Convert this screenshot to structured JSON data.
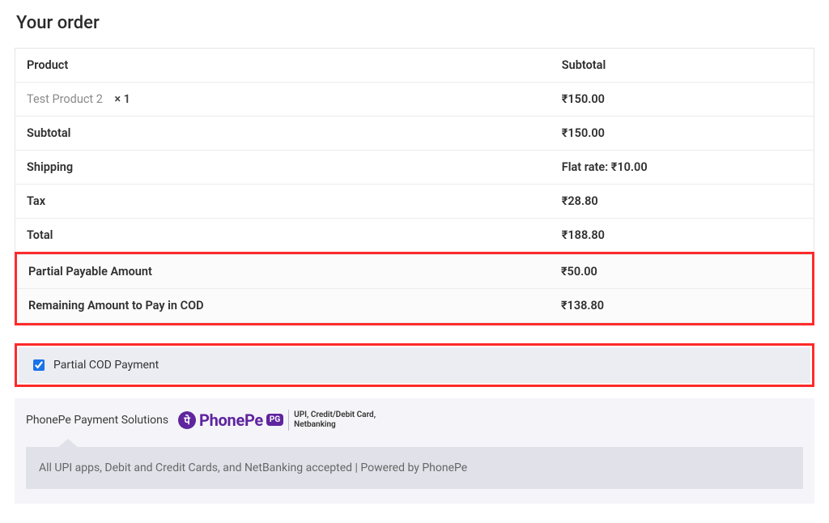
{
  "title": "Your order",
  "headers": {
    "product": "Product",
    "subtotal": "Subtotal"
  },
  "line_item": {
    "name": "Test Product 2",
    "qty_prefix": "× ",
    "qty": "1",
    "total": "₹150.00"
  },
  "rows": {
    "subtotal": {
      "label": "Subtotal",
      "value": "₹150.00"
    },
    "shipping": {
      "label": "Shipping",
      "value": "Flat rate: ₹10.00"
    },
    "tax": {
      "label": "Tax",
      "value": "₹28.80"
    },
    "total": {
      "label": "Total",
      "value": "₹188.80"
    },
    "partial_payable": {
      "label": "Partial Payable Amount",
      "value": "₹50.00"
    },
    "remaining_cod": {
      "label": "Remaining Amount to Pay in COD",
      "value": "₹138.80"
    }
  },
  "payment_option": {
    "label": "Partial COD Payment",
    "checked": true
  },
  "phonepe": {
    "title": "PhonePe Payment Solutions",
    "brand": "PhonePe",
    "badge": "PG",
    "tagline1": "UPI, Credit/Debit Card,",
    "tagline2": "Netbanking",
    "panel_text": "All UPI apps, Debit and Credit Cards, and NetBanking accepted | Powered by PhonePe"
  }
}
